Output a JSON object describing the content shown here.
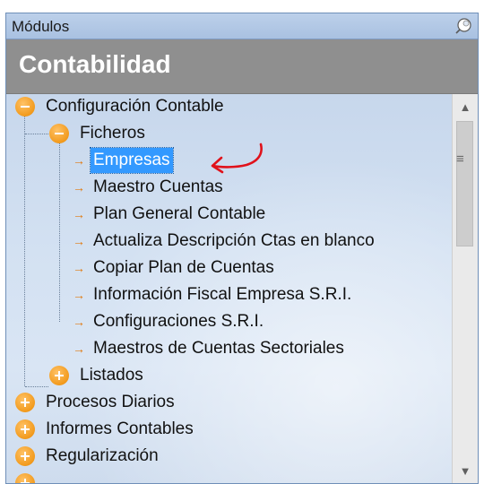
{
  "panel": {
    "title": "Módulos",
    "pin_icon": "pin-icon"
  },
  "header": {
    "title": "Contabilidad"
  },
  "tree": {
    "groups": [
      {
        "label": "Configuración Contable",
        "expanded": true,
        "children": [
          {
            "label": "Ficheros",
            "expanded": true,
            "items": [
              "Empresas",
              "Maestro Cuentas",
              "Plan General Contable",
              "Actualiza Descripción Ctas en blanco",
              "Copiar Plan de Cuentas",
              "Información Fiscal Empresa S.R.I.",
              "Configuraciones S.R.I.",
              "Maestros de Cuentas Sectoriales"
            ]
          },
          {
            "label": "Listados",
            "expanded": false
          }
        ]
      },
      {
        "label": "Procesos Diarios",
        "expanded": false
      },
      {
        "label": "Informes Contables",
        "expanded": false
      },
      {
        "label": "Regularización",
        "expanded": false
      }
    ],
    "selected_item": "Empresas"
  },
  "scrollbar": {
    "up_icon": "chevron-up-icon",
    "down_icon": "chevron-down-icon"
  },
  "annotation": {
    "arrow_color": "#e0121b"
  },
  "colors": {
    "expander": "#f29a1c",
    "selection": "#3399ff",
    "header_bg": "#8f8f8f",
    "titlebar_bg": "#a9c1e1"
  }
}
